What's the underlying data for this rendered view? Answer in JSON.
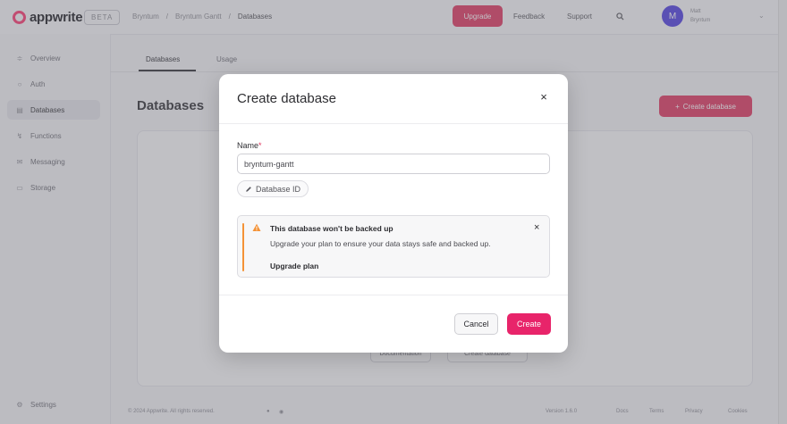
{
  "topbar": {
    "logo_text": "appwrite",
    "beta_badge": "BETA",
    "breadcrumbs": [
      "Bryntum",
      "/",
      "Bryntum Gantt",
      "/",
      "Databases"
    ],
    "breadcrumb_separator": "/",
    "upgrade_label": "Upgrade",
    "feedback_label": "Feedback",
    "support_label": "Support",
    "search_icon": "search-icon",
    "avatar_initial": "M",
    "user_name": "Matt",
    "user_org": "Bryntum"
  },
  "sidebar": {
    "items": [
      {
        "label": "Overview",
        "icon": "chart-icon"
      },
      {
        "label": "Auth",
        "icon": "user-icon"
      },
      {
        "label": "Databases",
        "icon": "database-icon"
      },
      {
        "label": "Functions",
        "icon": "lightning-icon"
      },
      {
        "label": "Messaging",
        "icon": "message-icon"
      },
      {
        "label": "Storage",
        "icon": "folder-icon"
      }
    ],
    "settings_label": "Settings"
  },
  "main": {
    "tabs": [
      "Databases",
      "Usage"
    ],
    "page_title": "Databases",
    "create_button": "Create database",
    "empty_buttons": [
      "Documentation",
      "Create database"
    ],
    "footer": {
      "copyright": "© 2024 Appwrite. All rights reserved.",
      "version": "Version 1.6.0",
      "links": [
        "Docs",
        "Terms",
        "Privacy",
        "Cookies"
      ]
    }
  },
  "modal": {
    "title": "Create database",
    "name_label": "Name",
    "required_mark": "*",
    "name_value": "bryntum-gantt",
    "database_id_label": "Database ID",
    "alert": {
      "title": "This database won't be backed up",
      "body": "Upgrade your plan to ensure your data stays safe and backed up.",
      "link": "Upgrade plan"
    },
    "cancel_label": "Cancel",
    "create_label": "Create"
  },
  "colors": {
    "brand": "#fd366e",
    "primary_button": "#e8246a",
    "warning": "#f49236"
  }
}
